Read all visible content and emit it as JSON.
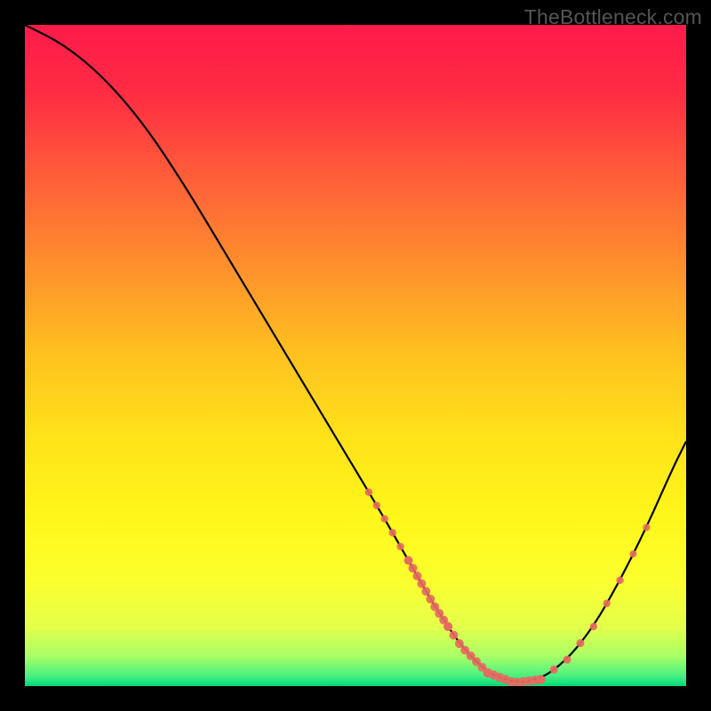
{
  "watermark": "TheBottleneck.com",
  "gradient": {
    "stops": [
      {
        "offset": 0.0,
        "color": "#ff1a4a"
      },
      {
        "offset": 0.1,
        "color": "#ff2b43"
      },
      {
        "offset": 0.22,
        "color": "#ff5a3a"
      },
      {
        "offset": 0.35,
        "color": "#ff8a2e"
      },
      {
        "offset": 0.5,
        "color": "#ffc21f"
      },
      {
        "offset": 0.62,
        "color": "#ffe11a"
      },
      {
        "offset": 0.74,
        "color": "#fff61a"
      },
      {
        "offset": 0.84,
        "color": "#fcff2e"
      },
      {
        "offset": 0.91,
        "color": "#e4ff4a"
      },
      {
        "offset": 0.955,
        "color": "#a8ff66"
      },
      {
        "offset": 0.985,
        "color": "#48f082"
      },
      {
        "offset": 1.0,
        "color": "#00d878"
      }
    ]
  },
  "chart_data": {
    "type": "line",
    "title": "",
    "xlabel": "",
    "ylabel": "",
    "xlim": [
      0,
      100
    ],
    "ylim": [
      0,
      100
    ],
    "curve": [
      {
        "x": 0,
        "y": 100
      },
      {
        "x": 6,
        "y": 97
      },
      {
        "x": 12,
        "y": 92
      },
      {
        "x": 18,
        "y": 85
      },
      {
        "x": 24,
        "y": 76
      },
      {
        "x": 30,
        "y": 66
      },
      {
        "x": 36,
        "y": 56
      },
      {
        "x": 42,
        "y": 46
      },
      {
        "x": 48,
        "y": 36
      },
      {
        "x": 54,
        "y": 26
      },
      {
        "x": 58,
        "y": 19
      },
      {
        "x": 62,
        "y": 12
      },
      {
        "x": 66,
        "y": 6
      },
      {
        "x": 70,
        "y": 2
      },
      {
        "x": 74,
        "y": 0.5
      },
      {
        "x": 78,
        "y": 1
      },
      {
        "x": 82,
        "y": 4
      },
      {
        "x": 86,
        "y": 9
      },
      {
        "x": 90,
        "y": 16
      },
      {
        "x": 94,
        "y": 24
      },
      {
        "x": 98,
        "y": 33
      },
      {
        "x": 100,
        "y": 37
      }
    ],
    "dot_clusters": [
      {
        "start_x": 52,
        "end_x": 58,
        "count": 6,
        "radius": 4.2
      },
      {
        "start_x": 58,
        "end_x": 64,
        "count": 10,
        "radius": 5.0
      },
      {
        "start_x": 64,
        "end_x": 70,
        "count": 8,
        "radius": 5.0
      },
      {
        "start_x": 70,
        "end_x": 78,
        "count": 10,
        "radius": 5.2
      },
      {
        "start_x": 78,
        "end_x": 84,
        "count": 4,
        "radius": 4.5
      },
      {
        "start_x": 86,
        "end_x": 90,
        "count": 3,
        "radius": 4.2
      },
      {
        "start_x": 92,
        "end_x": 94,
        "count": 2,
        "radius": 4.0
      }
    ],
    "dot_color": "#e76a61",
    "curve_color": "#000000"
  }
}
